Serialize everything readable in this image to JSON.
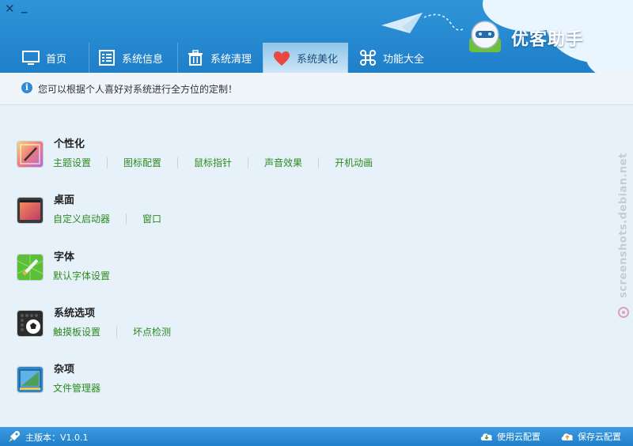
{
  "window": {
    "close_glyph": "✕",
    "minimize_glyph": "_"
  },
  "brand": {
    "name": "优客助手"
  },
  "tabs": [
    {
      "label": "首页",
      "icon": "monitor-icon"
    },
    {
      "label": "系统信息",
      "icon": "list-icon"
    },
    {
      "label": "系统清理",
      "icon": "trash-icon"
    },
    {
      "label": "系统美化",
      "icon": "heart-icon",
      "active": true
    },
    {
      "label": "功能大全",
      "icon": "command-icon"
    }
  ],
  "info": {
    "text": "您可以根据个人喜好对系统进行全方位的定制！",
    "icon_glyph": "i"
  },
  "sections": [
    {
      "title": "个性化",
      "icon": "personalize-icon",
      "links": [
        "主题设置",
        "图标配置",
        "鼠标指针",
        "声音效果",
        "开机动画"
      ]
    },
    {
      "title": "桌面",
      "icon": "desktop-icon",
      "links": [
        "自定义启动器",
        "窗口"
      ]
    },
    {
      "title": "字体",
      "icon": "font-icon",
      "links": [
        "默认字体设置"
      ]
    },
    {
      "title": "系统选项",
      "icon": "system-options-icon",
      "links": [
        "触摸板设置",
        "坏点检测"
      ]
    },
    {
      "title": "杂项",
      "icon": "misc-icon",
      "links": [
        "文件管理器"
      ]
    }
  ],
  "watermark": {
    "text": "screenshots.debian.net"
  },
  "footer": {
    "version": "主版本：V1.0.1",
    "use_cloud": "使用云配置",
    "save_cloud": "保存云配置"
  },
  "colors": {
    "link": "#2d8b1f",
    "header": "#2688d0",
    "active_tab": "#cfe6f6"
  }
}
